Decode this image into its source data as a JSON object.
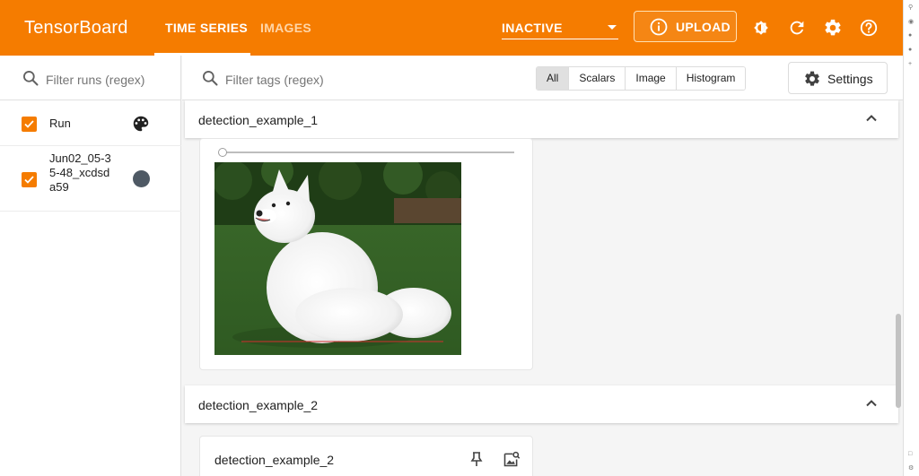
{
  "app": {
    "title": "TensorBoard"
  },
  "nav": {
    "tabs": [
      {
        "label": "TIME SERIES",
        "active": true
      },
      {
        "label": "IMAGES",
        "active": false
      }
    ]
  },
  "plugin_select": {
    "value": "INACTIVE"
  },
  "upload": {
    "label": "UPLOAD"
  },
  "header_icons": [
    "theme-toggle-icon",
    "reload-icon",
    "settings-gear-icon",
    "help-icon"
  ],
  "sidebar": {
    "filter": {
      "placeholder": "Filter runs (regex)"
    },
    "header_row": {
      "label": "Run",
      "checked": true
    },
    "runs": [
      {
        "label": "Jun02_05-35-48_xcdsda59",
        "checked": true,
        "color": "#4e5964"
      }
    ]
  },
  "toolbar": {
    "filter": {
      "placeholder": "Filter tags (regex)"
    },
    "types": [
      "All",
      "Scalars",
      "Image",
      "Histogram"
    ],
    "selected_type": "All",
    "settings_label": "Settings"
  },
  "groups": [
    {
      "title": "detection_example_1",
      "expanded": true
    },
    {
      "title": "detection_example_2",
      "expanded": true
    }
  ],
  "cards": [
    {
      "title": "detection_example_2"
    }
  ],
  "colors": {
    "accent": "#f57c00",
    "run_color": "#4e5964"
  }
}
